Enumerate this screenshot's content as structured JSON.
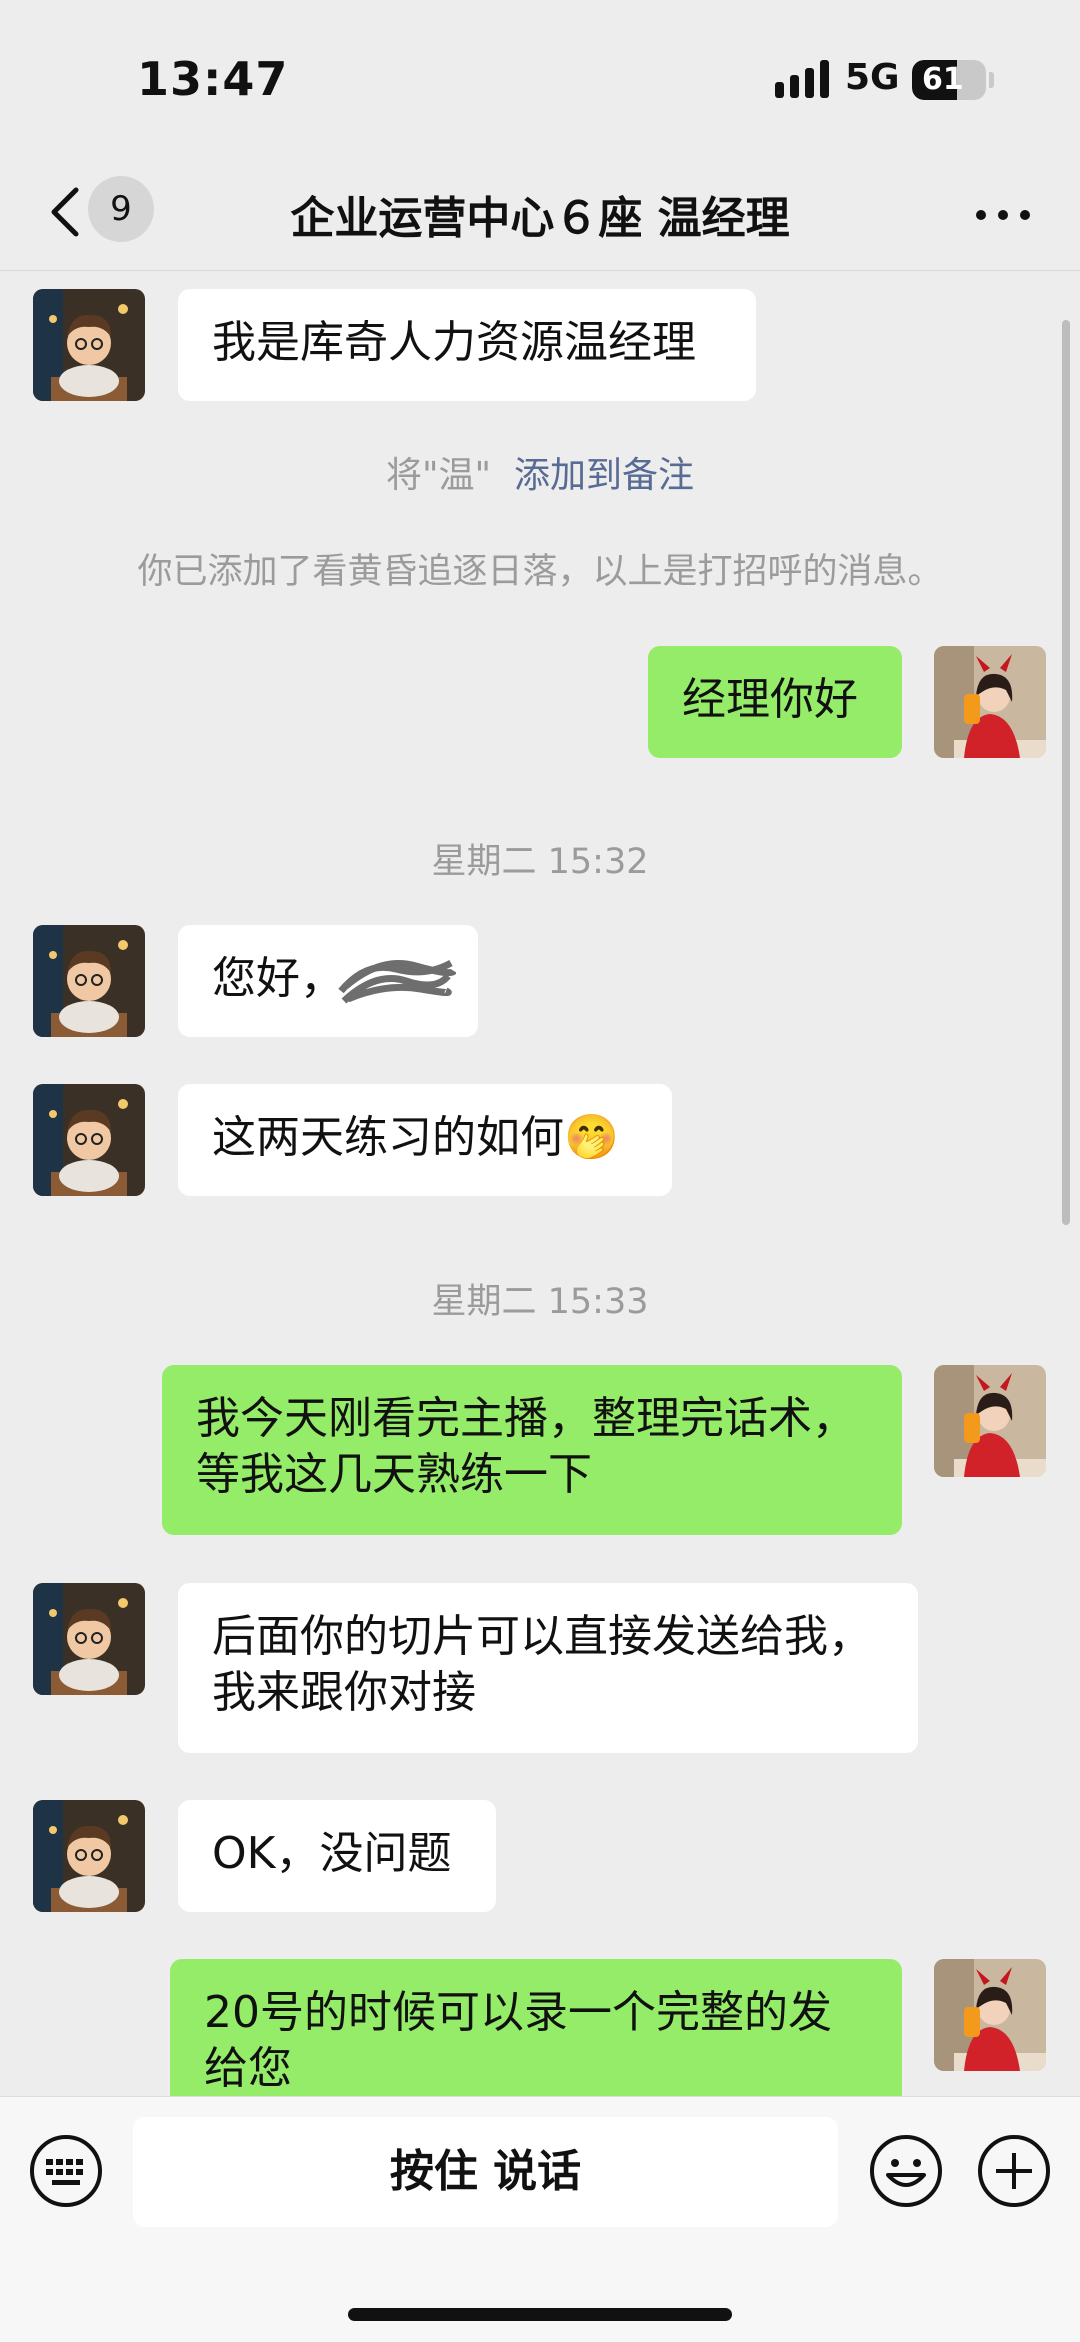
{
  "status_bar": {
    "time": "13:47",
    "network": "5G",
    "battery": "61",
    "battery_level": 0.61
  },
  "nav": {
    "unread_count": "9",
    "title": "企业运营中心６座 温经理",
    "back_icon": "chevron-left-icon",
    "more_icon": "more-dots-icon"
  },
  "messages": {
    "m1": "我是库奇人力资源温经理",
    "remark_prefix": "将\"温\"",
    "remark_link": "添加到备注",
    "added_notice": "你已添加了看黄昏追逐日落，以上是打招呼的消息。",
    "m2": "经理你好",
    "time1": "星期二 15:32",
    "m3": "您好，",
    "m4": "这两天练习的如何",
    "m4_emoji": "🤭",
    "time2": "星期二 15:33",
    "m5_line1": "我今天刚看完主播，整理完话术，",
    "m5_line2": "等我这几天熟练一下",
    "m6_line1": "后面你的切片可以直接发送给我，",
    "m6_line2": "我来跟你对接",
    "m7": "OK，没问题",
    "m8_line1": "20号的时候可以录一个完整的发",
    "m8_line2": "给您"
  },
  "input_bar": {
    "talk_label": "按住 说话",
    "keyboard_icon": "keyboard-icon",
    "emoji_icon": "smiley-icon",
    "plus_icon": "plus-circle-icon"
  },
  "colors": {
    "background": "#ededed",
    "outgoing_bubble": "#95ec69",
    "incoming_bubble": "#ffffff",
    "link": "#576b95"
  }
}
